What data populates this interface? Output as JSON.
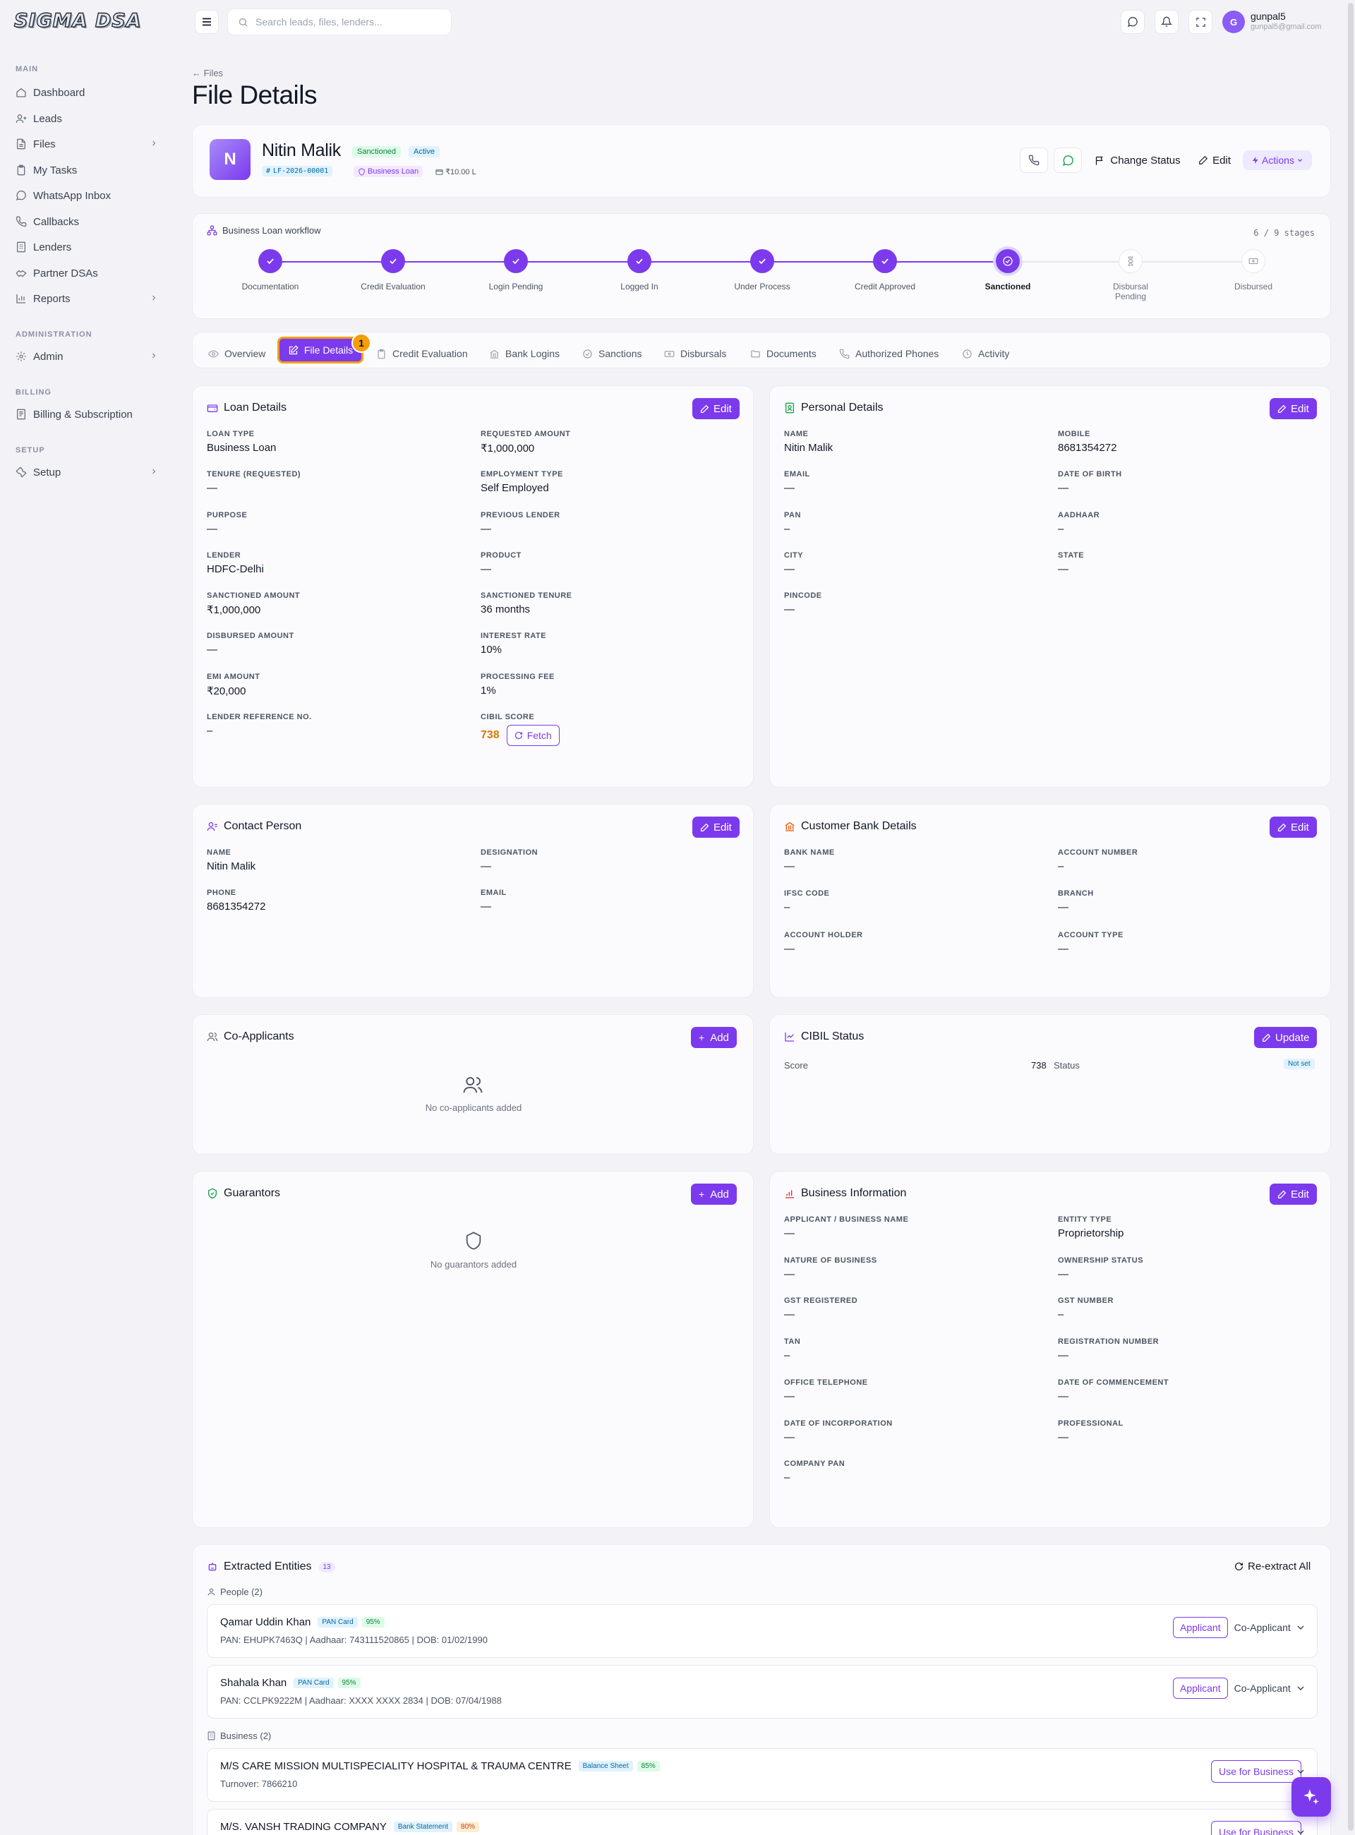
{
  "app": {
    "logo": "SIGMA DSA"
  },
  "sidebar": {
    "sections": {
      "main": "MAIN",
      "administration": "ADMINISTRATION",
      "billing": "BILLING",
      "setup": "SETUP"
    },
    "items": [
      {
        "label": "Dashboard",
        "icon": "home-icon"
      },
      {
        "label": "Leads",
        "icon": "users-icon"
      },
      {
        "label": "Files",
        "icon": "file-icon"
      },
      {
        "label": "My Tasks",
        "icon": "clipboard-icon"
      },
      {
        "label": "WhatsApp Inbox",
        "icon": "whatsapp-icon"
      },
      {
        "label": "Callbacks",
        "icon": "phone-icon"
      },
      {
        "label": "Lenders",
        "icon": "building-icon"
      },
      {
        "label": "Partner DSAs",
        "icon": "handshake-icon"
      },
      {
        "label": "Reports",
        "icon": "chart-icon"
      },
      {
        "label": "Admin",
        "icon": "gear-icon"
      },
      {
        "label": "Billing & Subscription",
        "icon": "receipt-icon"
      },
      {
        "label": "Setup",
        "icon": "wrench-icon"
      }
    ]
  },
  "topbar": {
    "search_placeholder": "Search leads, files, lenders...",
    "user": {
      "initial": "G",
      "name": "gunpal5",
      "email": "gunpal5@gmail.com"
    }
  },
  "page": {
    "breadcrumb": "← Files",
    "title": "File Details"
  },
  "file": {
    "initial": "N",
    "name": "Nitin Malik",
    "status_badge": "Sanctioned",
    "state_badge": "Active",
    "file_id": "LF-2026-00001",
    "loan_type": "Business Loan",
    "amount": "₹10.00 L",
    "actions": {
      "change_status": "Change Status",
      "edit": "Edit",
      "actions": "Actions"
    }
  },
  "workflow": {
    "title": "Business Loan workflow",
    "count": "6 / 9 stages",
    "stages": [
      {
        "label": "Documentation",
        "state": "done"
      },
      {
        "label": "Credit Evaluation",
        "state": "done"
      },
      {
        "label": "Login Pending",
        "state": "done"
      },
      {
        "label": "Logged In",
        "state": "done"
      },
      {
        "label": "Under Process",
        "state": "done"
      },
      {
        "label": "Credit Approved",
        "state": "done"
      },
      {
        "label": "Sanctioned",
        "state": "current"
      },
      {
        "label": "Disbursal Pending",
        "state": "todo"
      },
      {
        "label": "Disbursed",
        "state": "todo"
      }
    ]
  },
  "tabs": [
    "Overview",
    "File Details",
    "Credit Evaluation",
    "Bank Logins",
    "Sanctions",
    "Disbursals",
    "Documents",
    "Authorized Phones",
    "Activity"
  ],
  "step_marker": "1",
  "buttons": {
    "edit": "Edit",
    "add": "Add",
    "update": "Update",
    "fetch": "Fetch"
  },
  "loan_details": {
    "title": "Loan Details",
    "fields": [
      {
        "label": "LOAN TYPE",
        "value": "Business Loan"
      },
      {
        "label": "REQUESTED AMOUNT",
        "value": "₹1,000,000"
      },
      {
        "label": "TENURE (REQUESTED)",
        "value": "—"
      },
      {
        "label": "EMPLOYMENT TYPE",
        "value": "Self Employed"
      },
      {
        "label": "PURPOSE",
        "value": "—"
      },
      {
        "label": "PREVIOUS LENDER",
        "value": "—"
      },
      {
        "label": "LENDER",
        "value": "HDFC-Delhi"
      },
      {
        "label": "PRODUCT",
        "value": "—"
      },
      {
        "label": "SANCTIONED AMOUNT",
        "value": "₹1,000,000"
      },
      {
        "label": "SANCTIONED TENURE",
        "value": "36 months"
      },
      {
        "label": "DISBURSED AMOUNT",
        "value": "—"
      },
      {
        "label": "INTEREST RATE",
        "value": "10%"
      },
      {
        "label": "EMI AMOUNT",
        "value": "₹20,000"
      },
      {
        "label": "PROCESSING FEE",
        "value": "1%"
      },
      {
        "label": "LENDER REFERENCE NO.",
        "value": "–"
      },
      {
        "label": "CIBIL SCORE",
        "value": "738"
      }
    ]
  },
  "personal_details": {
    "title": "Personal Details",
    "fields": [
      {
        "label": "NAME",
        "value": "Nitin Malik"
      },
      {
        "label": "MOBILE",
        "value": "8681354272"
      },
      {
        "label": "EMAIL",
        "value": "—"
      },
      {
        "label": "DATE OF BIRTH",
        "value": "—"
      },
      {
        "label": "PAN",
        "value": "–"
      },
      {
        "label": "AADHAAR",
        "value": "–"
      },
      {
        "label": "CITY",
        "value": "—"
      },
      {
        "label": "STATE",
        "value": "—"
      },
      {
        "label": "PINCODE",
        "value": "—"
      }
    ]
  },
  "contact_person": {
    "title": "Contact Person",
    "fields": [
      {
        "label": "NAME",
        "value": "Nitin Malik"
      },
      {
        "label": "DESIGNATION",
        "value": "—"
      },
      {
        "label": "PHONE",
        "value": "8681354272"
      },
      {
        "label": "EMAIL",
        "value": "—"
      }
    ]
  },
  "bank_details": {
    "title": "Customer Bank Details",
    "fields": [
      {
        "label": "BANK NAME",
        "value": "—"
      },
      {
        "label": "ACCOUNT NUMBER",
        "value": "–"
      },
      {
        "label": "IFSC CODE",
        "value": "–"
      },
      {
        "label": "BRANCH",
        "value": "—"
      },
      {
        "label": "ACCOUNT HOLDER",
        "value": "—"
      },
      {
        "label": "ACCOUNT TYPE",
        "value": "—"
      }
    ]
  },
  "co_applicants": {
    "title": "Co-Applicants",
    "empty": "No co-applicants added"
  },
  "cibil_status": {
    "title": "CIBIL Status",
    "score_label": "Score",
    "score": "738",
    "status_label": "Status",
    "status": "Not set"
  },
  "guarantors": {
    "title": "Guarantors",
    "empty": "No guarantors added"
  },
  "business_info": {
    "title": "Business Information",
    "fields": [
      {
        "label": "APPLICANT / BUSINESS NAME",
        "value": "—"
      },
      {
        "label": "ENTITY TYPE",
        "value": "Proprietorship"
      },
      {
        "label": "NATURE OF BUSINESS",
        "value": "—"
      },
      {
        "label": "OWNERSHIP STATUS",
        "value": "—"
      },
      {
        "label": "GST REGISTERED",
        "value": "—"
      },
      {
        "label": "GST NUMBER",
        "value": "–"
      },
      {
        "label": "TAN",
        "value": "–"
      },
      {
        "label": "REGISTRATION NUMBER",
        "value": "—"
      },
      {
        "label": "OFFICE TELEPHONE",
        "value": "—"
      },
      {
        "label": "DATE OF COMMENCEMENT",
        "value": "—"
      },
      {
        "label": "DATE OF INCORPORATION",
        "value": "—"
      },
      {
        "label": "PROFESSIONAL",
        "value": "—"
      },
      {
        "label": "COMPANY PAN",
        "value": "–"
      }
    ]
  },
  "extracted": {
    "title": "Extracted Entities",
    "count": "13",
    "reextract": "Re-extract All",
    "people_title": "People (2)",
    "business_title": "Business (2)",
    "people": [
      {
        "name": "Qamar Uddin Khan",
        "doc": "PAN Card",
        "conf": "95%",
        "detail": "PAN: EHUPK7463Q | Aadhaar: 743111520865 | DOB: 01/02/1990",
        "opt_a": "Applicant",
        "opt_b": "Co-Applicant"
      },
      {
        "name": "Shahala Khan",
        "doc": "PAN Card",
        "conf": "95%",
        "detail": "PAN: CCLPK9222M | Aadhaar: XXXX XXXX 2834 | DOB: 07/04/1988",
        "opt_a": "Applicant",
        "opt_b": "Co-Applicant"
      }
    ],
    "business": [
      {
        "name": "M/S CARE MISSION MULTISPECIALITY HOSPITAL & TRAUMA CENTRE",
        "doc": "Balance Sheet",
        "conf": "85%",
        "detail": "Turnover: 7866210",
        "action": "Use for Business"
      },
      {
        "name": "M/S. VANSH TRADING COMPANY",
        "doc": "Bank Statement",
        "conf": "80%",
        "detail": "",
        "action": "Use for Business"
      }
    ]
  }
}
